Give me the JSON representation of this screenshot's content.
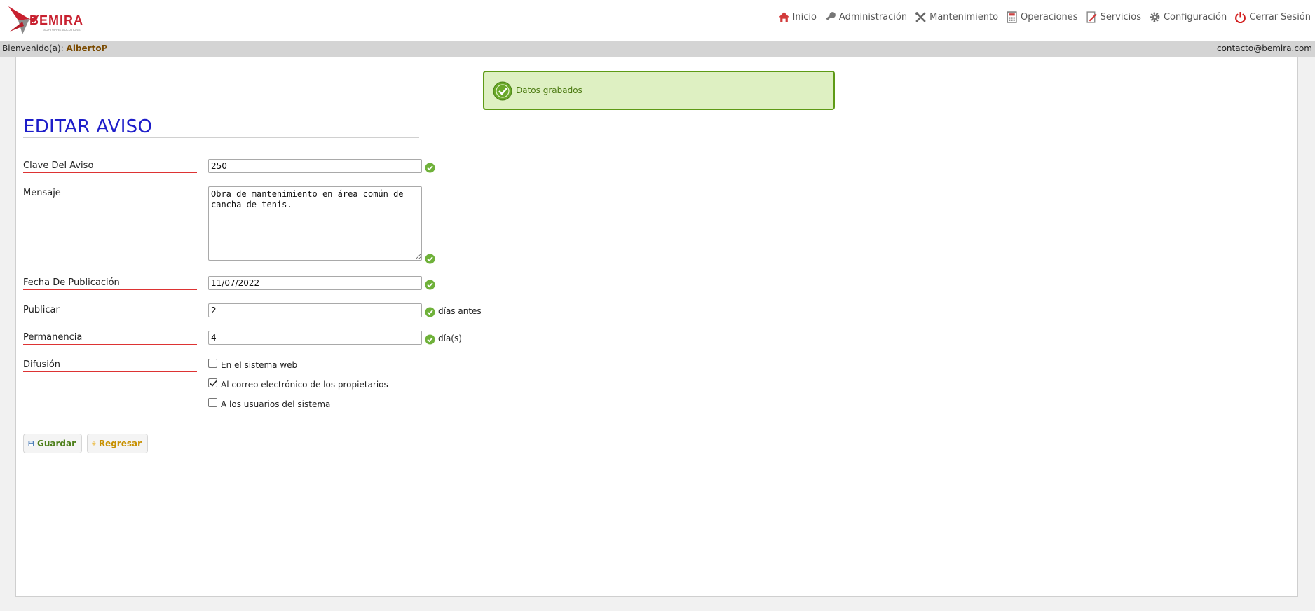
{
  "brand": {
    "name": "BEMIRA",
    "tagline": "SOFTWARE SOLUTIONS"
  },
  "nav": [
    {
      "label": "Inicio",
      "icon": "home-icon"
    },
    {
      "label": "Administración",
      "icon": "key-icon"
    },
    {
      "label": "Mantenimiento",
      "icon": "tools-icon"
    },
    {
      "label": "Operaciones",
      "icon": "calculator-icon"
    },
    {
      "label": "Servicios",
      "icon": "document-edit-icon"
    },
    {
      "label": "Configuración",
      "icon": "gear-icon"
    },
    {
      "label": "Cerrar Sesión",
      "icon": "power-icon"
    }
  ],
  "userbar": {
    "welcome_prefix": "Bienvenido(a):",
    "username": "AlbertoP",
    "contact": "contacto@bemira.com"
  },
  "notice": {
    "text": "Datos grabados",
    "icon": "check-circle-icon"
  },
  "page_title": "EDITAR AVISO",
  "form": {
    "clave": {
      "label": "Clave Del Aviso",
      "value": "250"
    },
    "mensaje": {
      "label": "Mensaje",
      "value": "Obra de mantenimiento en área común de cancha de tenis."
    },
    "fecha": {
      "label": "Fecha De Publicación",
      "value": "11/07/2022"
    },
    "publicar": {
      "label": "Publicar",
      "value": "2",
      "suffix": "días antes"
    },
    "permanencia": {
      "label": "Permanencia",
      "value": "4",
      "suffix": "día(s)"
    },
    "difusion": {
      "label": "Difusión",
      "options": [
        {
          "label": "En el sistema web",
          "checked": false
        },
        {
          "label": "Al correo electrónico de los propietarios",
          "checked": true
        },
        {
          "label": "A los usuarios del sistema",
          "checked": false
        }
      ]
    }
  },
  "buttons": {
    "save": "Guardar",
    "back": "Regresar"
  },
  "colors": {
    "title": "#1d1dc9",
    "label_underline": "#dd3333",
    "notice_bg": "#def0c2",
    "notice_border": "#5e9a16",
    "brand_red": "#c8202f"
  }
}
